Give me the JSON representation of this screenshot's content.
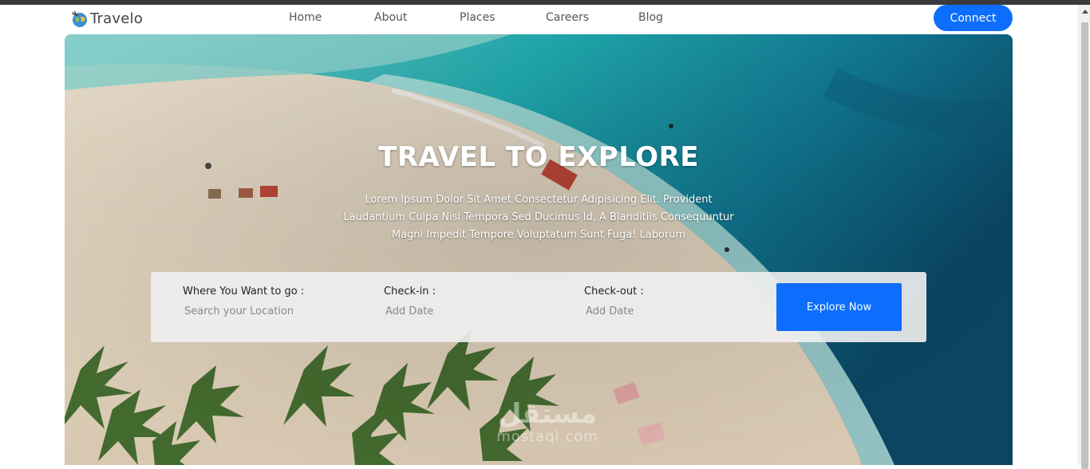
{
  "brand": {
    "name": "Travelo",
    "logo_icon": "globe-plane-icon"
  },
  "nav": {
    "items": [
      "Home",
      "About",
      "Places",
      "Careers",
      "Blog"
    ],
    "connect_label": "Connect"
  },
  "hero": {
    "title": "TRAVEL TO EXPLORE",
    "description": "Lorem Ipsum Dolor Sit Amet Consectetur Adipisicing Elit. Provident Laudantium Culpa Nisi Tempora Sed Ducimus Id, A Blanditiis Consequuntur Magni Impedit Tempore Voluptatum Sunt Fuga! Laborum"
  },
  "search": {
    "location": {
      "label": "Where You Want to go :",
      "placeholder": "Search your Location"
    },
    "checkin": {
      "label": "Check-in :",
      "placeholder": "Add Date"
    },
    "checkout": {
      "label": "Check-out :",
      "placeholder": "Add Date"
    },
    "button_label": "Explore Now"
  },
  "watermark": {
    "arabic": "مستقل",
    "latin": "mostaql.com"
  },
  "colors": {
    "accent": "#0d6efd",
    "sand": "#e9d9c2",
    "sea": "#1eb3b8",
    "deep_sea": "#0c4f6e"
  }
}
